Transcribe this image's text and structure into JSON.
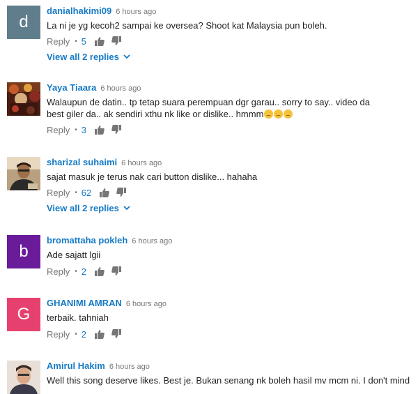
{
  "comments": [
    {
      "author": "danialhakimi09",
      "time": "6 hours ago",
      "avatar_letter": "d",
      "avatar_color": "#607d8b",
      "text": "La ni je yg kecoh2 sampai ke oversea? Shoot kat Malaysia pun boleh.",
      "reply_label": "Reply",
      "likes": "5",
      "view_replies": "View all 2 replies"
    },
    {
      "author": "Yaya Tiaara",
      "time": "6 hours ago",
      "avatar_letter": "",
      "avatar_color": "#5a2a1a",
      "text": "Walaupun de datin.. tp tetap suara perempuan dgr garau.. sorry to say.. video da best giler da.. ak sendiri xthu nk like or dislike.. hmmm",
      "emojis": "😞😞😞",
      "reply_label": "Reply",
      "likes": "3"
    },
    {
      "author": "sharizal suhaimi",
      "time": "6 hours ago",
      "avatar_letter": "",
      "avatar_color": "#8a6a4a",
      "text": "sajat masuk je terus nak cari button dislike... hahaha",
      "reply_label": "Reply",
      "likes": "62",
      "view_replies": "View all 2 replies"
    },
    {
      "author": "bromattaha pokleh",
      "time": "6 hours ago",
      "avatar_letter": "b",
      "avatar_color": "#6a1b9a",
      "text": "Ade sajatt lgii",
      "reply_label": "Reply",
      "likes": "2"
    },
    {
      "author": "GHANIMI AMRAN",
      "time": "6 hours ago",
      "avatar_letter": "G",
      "avatar_color": "#e6416e",
      "text": "terbaik. tahniah",
      "reply_label": "Reply",
      "likes": "2"
    },
    {
      "author": "Amirul Hakim",
      "time": "6 hours ago",
      "avatar_letter": "",
      "avatar_color": "#c9b8a8",
      "text": "Well this song deserve likes. Best je. Bukan senang nk boleh hasil mv mcm ni. I don't mind"
    }
  ],
  "colors": {
    "author": "#167ac6",
    "meta": "#767676",
    "icon": "#767676"
  }
}
